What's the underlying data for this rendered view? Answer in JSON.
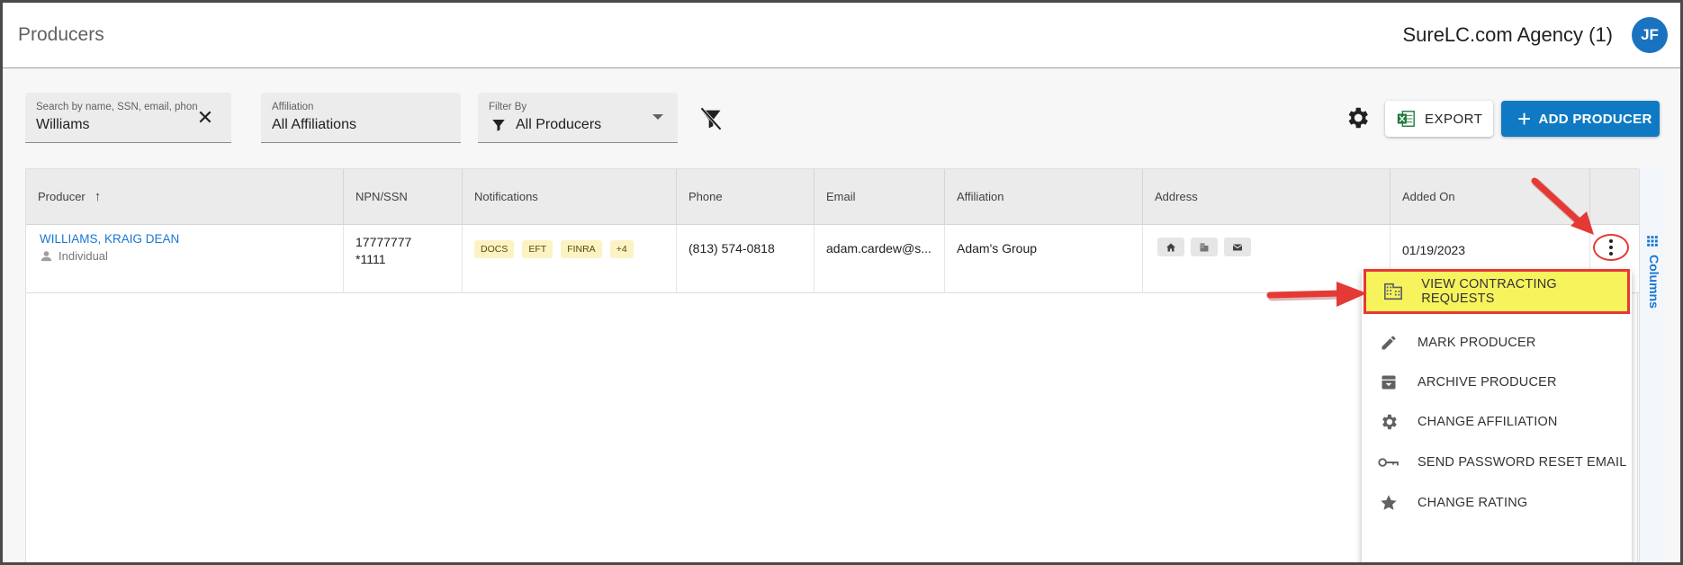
{
  "header": {
    "title": "Producers",
    "agency": "SureLC.com Agency (1)",
    "avatar_initials": "JF"
  },
  "filters": {
    "search": {
      "label": "Search by name, SSN, email, phon...",
      "value": "Williams"
    },
    "affiliation": {
      "label": "Affiliation",
      "value": "All Affiliations"
    },
    "filter_by": {
      "label": "Filter By",
      "value": "All Producers"
    }
  },
  "toolbar": {
    "export_label": "EXPORT",
    "add_label": "ADD PRODUCER"
  },
  "table": {
    "columns": [
      "Producer",
      "NPN/SSN",
      "Notifications",
      "Phone",
      "Email",
      "Affiliation",
      "Address",
      "Added On"
    ],
    "rows": [
      {
        "name": "WILLIAMS, KRAIG DEAN",
        "type": "Individual",
        "npn": "17777777",
        "ssn": "*1111",
        "notifications": [
          "DOCS",
          "EFT",
          "FINRA",
          "+4"
        ],
        "phone": "(813) 574-0818",
        "email": "adam.cardew@s...",
        "affiliation": "Adam's Group",
        "added_on": "01/19/2023"
      }
    ]
  },
  "columns_tab": "Columns",
  "menu": {
    "items": [
      {
        "label": "VIEW CONTRACTING REQUESTS",
        "icon": "building-icon"
      },
      {
        "label": "MARK PRODUCER",
        "icon": "pencil-icon"
      },
      {
        "label": "ARCHIVE PRODUCER",
        "icon": "archive-icon"
      },
      {
        "label": "CHANGE AFFILIATION",
        "icon": "gear-icon"
      },
      {
        "label": "SEND PASSWORD RESET EMAIL",
        "icon": "key-icon"
      },
      {
        "label": "CHANGE RATING",
        "icon": "star-icon"
      }
    ]
  },
  "colors": {
    "primary": "#0f7ac3",
    "link": "#1976d2",
    "highlight": "#f7f35d",
    "annotation_red": "#e53935",
    "chip_bg": "#fbf3c4"
  }
}
